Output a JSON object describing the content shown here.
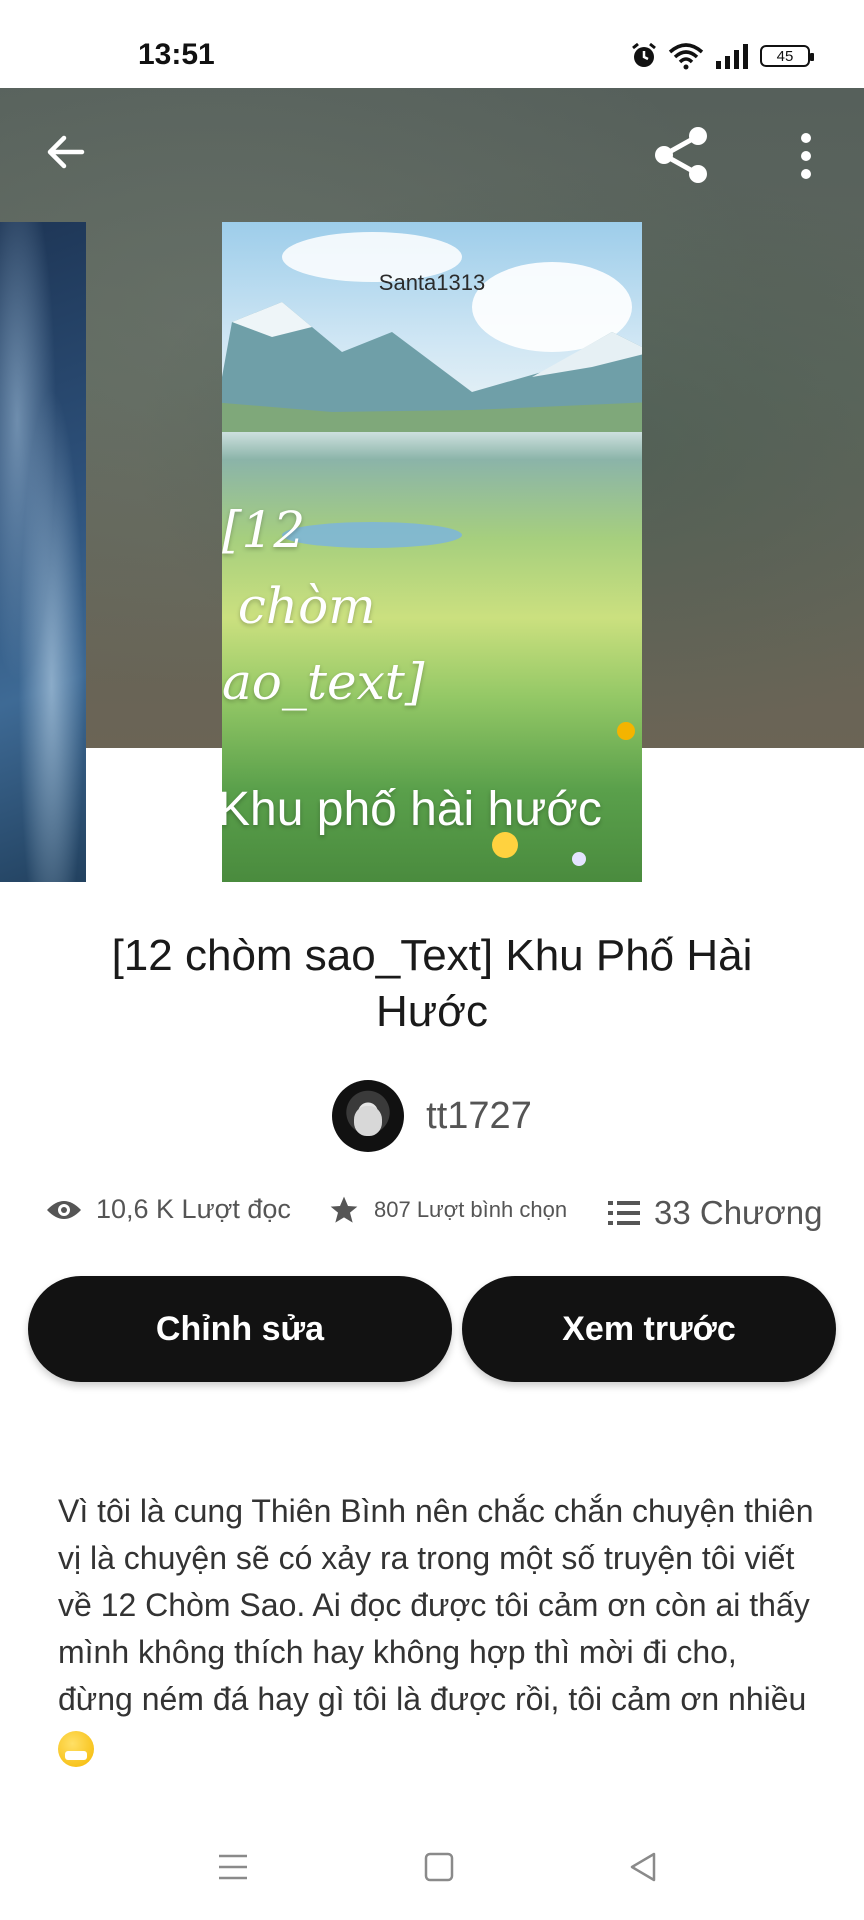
{
  "status_bar": {
    "time": "13:51",
    "battery": "45",
    "icons": [
      "alarm-icon",
      "wifi-icon",
      "signal-icon",
      "battery-icon"
    ]
  },
  "top_bar": {
    "icons": [
      "back-arrow-icon",
      "share-icon",
      "more-vertical-icon"
    ]
  },
  "cover": {
    "author_text": "Santa1313",
    "title_script": "[12\n chòm\nao_text]",
    "subtitle": "Khu phố hài hước"
  },
  "story": {
    "title": "[12 chòm sao_Text] Khu Phố Hài Hước",
    "author": "tt1727"
  },
  "stats": {
    "reads": "10,6 K Lượt đọc",
    "votes": "807 Lượt bình chọn",
    "parts": "33 Chương"
  },
  "actions": {
    "edit_label": "Chỉnh sửa",
    "preview_label": "Xem trước"
  },
  "description": {
    "text": "Vì tôi là cung Thiên Bình nên chắc chắn chuyện thiên vị là chuyện sẽ có xảy ra trong một số truyện tôi viết về 12 Chòm Sao. Ai đọc được tôi cảm ơn còn ai thấy mình không thích hay không hợp thì mời đi cho, đừng ném đá hay gì tôi là được rồi, tôi cảm ơn nhiều",
    "emoji": "sneezing-face"
  },
  "nav_bar": {
    "icons": [
      "menu-icon",
      "home-icon",
      "back-icon"
    ]
  },
  "colors": {
    "button_bg": "#121212",
    "button_text": "#ffffff",
    "header_bg": "#5e675d"
  }
}
